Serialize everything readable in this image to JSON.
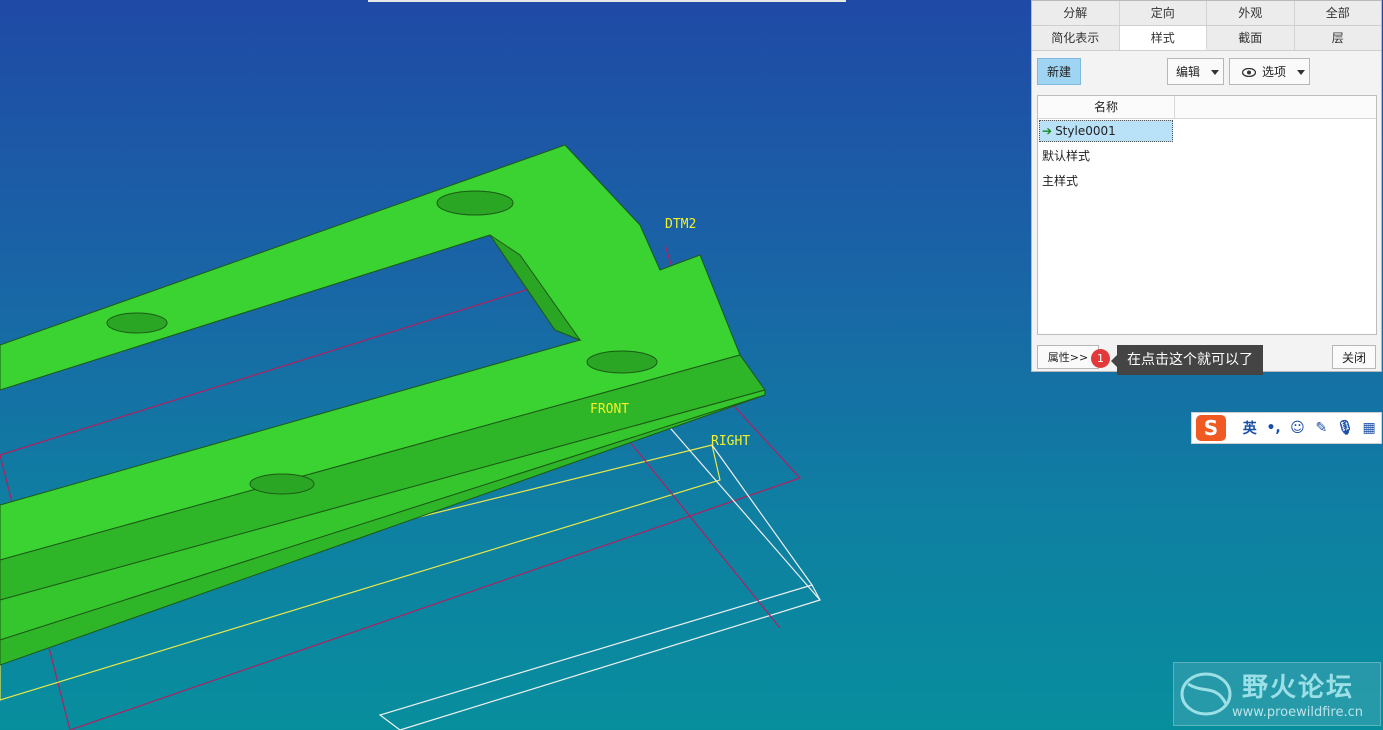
{
  "tabs_row1": [
    "分解",
    "定向",
    "外观",
    "全部"
  ],
  "tabs_row2": [
    "简化表示",
    "样式",
    "截面",
    "层"
  ],
  "active_tab": "样式",
  "toolbar": {
    "new_label": "新建",
    "edit_label": "编辑",
    "options_label": "选项"
  },
  "list": {
    "header": "名称",
    "items": [
      "Style0001",
      "默认样式",
      "主样式"
    ],
    "selected": "Style0001"
  },
  "footer": {
    "props_label": "属性>>",
    "close_label": "关闭"
  },
  "callout": {
    "number": "1",
    "text": "在点击这个就可以了"
  },
  "datums": {
    "dtm2": "DTM2",
    "front": "FRONT",
    "right": "RIGHT"
  },
  "ime": {
    "logo": "S",
    "lang": "英",
    "punct": "•,"
  },
  "watermark": {
    "title": "野火论坛",
    "url": "www.proewildfire.cn"
  },
  "colors": {
    "model": "#3ad332",
    "datum_text": "#f2f22a",
    "frame_red": "#b02060",
    "frame_yellow": "#e8e84a"
  }
}
